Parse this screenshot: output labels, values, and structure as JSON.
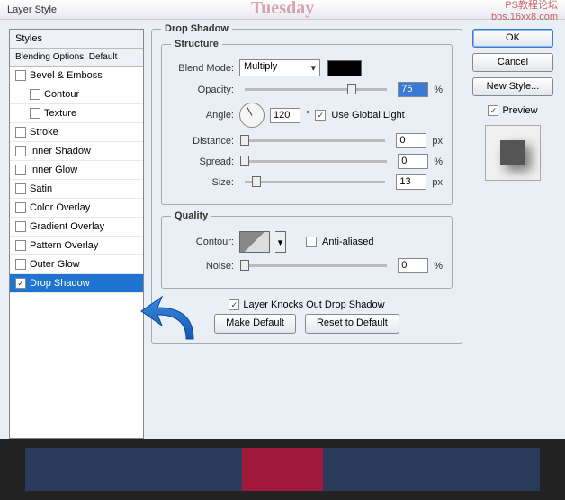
{
  "titlebar": {
    "title": "Layer Style",
    "watermark_line1": "PS教程论坛",
    "watermark_line2": "bbs.16xx8.com"
  },
  "sidebar": {
    "header": "Styles",
    "subheader": "Blending Options: Default",
    "items": [
      {
        "label": "Bevel & Emboss",
        "checked": false,
        "selected": false,
        "indent": false
      },
      {
        "label": "Contour",
        "checked": false,
        "selected": false,
        "indent": true
      },
      {
        "label": "Texture",
        "checked": false,
        "selected": false,
        "indent": true
      },
      {
        "label": "Stroke",
        "checked": false,
        "selected": false,
        "indent": false
      },
      {
        "label": "Inner Shadow",
        "checked": false,
        "selected": false,
        "indent": false
      },
      {
        "label": "Inner Glow",
        "checked": false,
        "selected": false,
        "indent": false
      },
      {
        "label": "Satin",
        "checked": false,
        "selected": false,
        "indent": false
      },
      {
        "label": "Color Overlay",
        "checked": false,
        "selected": false,
        "indent": false
      },
      {
        "label": "Gradient Overlay",
        "checked": false,
        "selected": false,
        "indent": false
      },
      {
        "label": "Pattern Overlay",
        "checked": false,
        "selected": false,
        "indent": false
      },
      {
        "label": "Outer Glow",
        "checked": false,
        "selected": false,
        "indent": false
      },
      {
        "label": "Drop Shadow",
        "checked": true,
        "selected": true,
        "indent": false
      }
    ]
  },
  "panel": {
    "title": "Drop Shadow",
    "structure_title": "Structure",
    "blend_mode_label": "Blend Mode:",
    "blend_mode_value": "Multiply",
    "opacity_label": "Opacity:",
    "opacity_value": "75",
    "opacity_unit": "%",
    "angle_label": "Angle:",
    "angle_value": "120",
    "angle_unit": "°",
    "global_light_label": "Use Global Light",
    "global_light_checked": true,
    "distance_label": "Distance:",
    "distance_value": "0",
    "distance_unit": "px",
    "spread_label": "Spread:",
    "spread_value": "0",
    "spread_unit": "%",
    "size_label": "Size:",
    "size_value": "13",
    "size_unit": "px",
    "quality_title": "Quality",
    "contour_label": "Contour:",
    "anti_aliased_label": "Anti-aliased",
    "anti_aliased_checked": false,
    "noise_label": "Noise:",
    "noise_value": "0",
    "noise_unit": "%",
    "knockout_label": "Layer Knocks Out Drop Shadow",
    "knockout_checked": true,
    "make_default": "Make Default",
    "reset_default": "Reset to Default"
  },
  "right": {
    "ok": "OK",
    "cancel": "Cancel",
    "new_style": "New Style...",
    "preview_label": "Preview",
    "preview_checked": true
  },
  "bg_text": "Tuesday"
}
